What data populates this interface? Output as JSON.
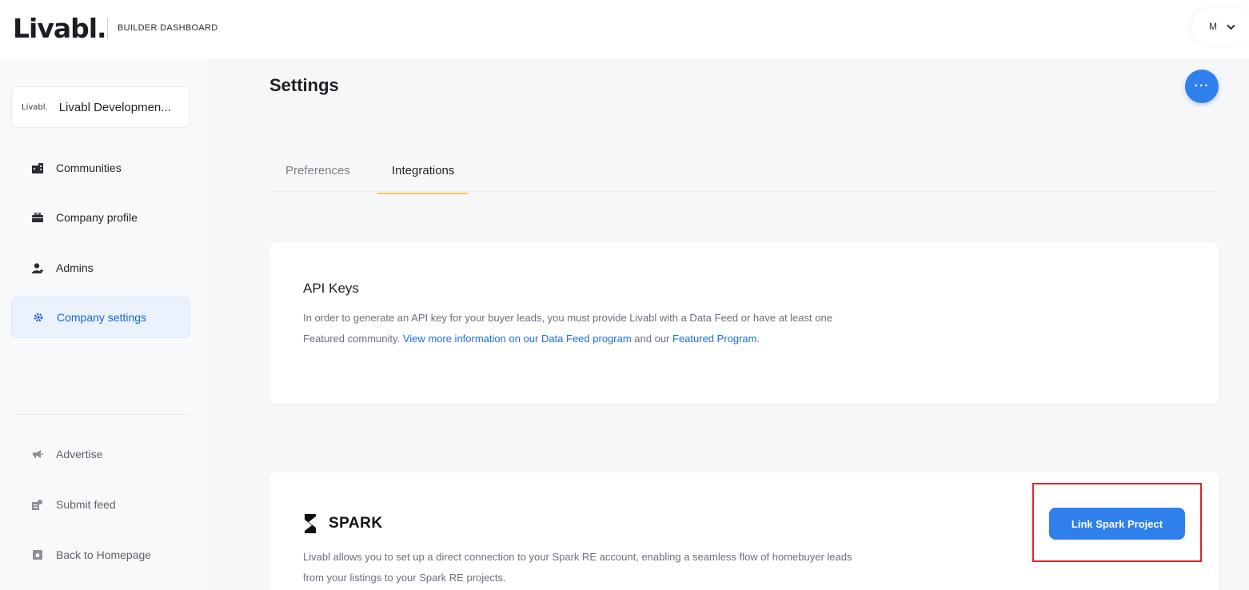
{
  "header": {
    "logo_text": "Livabl.",
    "dashboard_label": "BUILDER DASHBOARD",
    "user_initial": "M",
    "caret": "⌄"
  },
  "sidebar": {
    "company": {
      "mini_logo": "Livabl.",
      "name": "Livabl Developmen..."
    },
    "items": [
      {
        "label": "Communities",
        "icon": "building-icon",
        "active": false
      },
      {
        "label": "Company profile",
        "icon": "briefcase-icon",
        "active": false
      },
      {
        "label": "Admins",
        "icon": "user-add-icon",
        "active": false
      },
      {
        "label": "Company settings",
        "icon": "gear-icon",
        "active": true
      }
    ],
    "secondary_items": [
      {
        "label": "Advertise",
        "icon": "megaphone-icon"
      },
      {
        "label": "Submit feed",
        "icon": "feed-icon"
      },
      {
        "label": "Back to Homepage",
        "icon": "home-icon"
      }
    ]
  },
  "main": {
    "title": "Settings",
    "more_button": "···",
    "tabs": [
      {
        "label": "Preferences",
        "active": false
      },
      {
        "label": "Integrations",
        "active": true
      }
    ],
    "api_card": {
      "title": "API Keys",
      "text_1": "In order to generate an API key for your buyer leads, you must provide Livabl with a Data Feed or have at least one Featured community. ",
      "link_1": "View more information on our Data Feed program",
      "text_2": " and our ",
      "link_2": "Featured Program",
      "text_3": "."
    },
    "spark_card": {
      "brand": "SPARK",
      "button_label": "Link Spark Project",
      "description": "Livabl allows you to set up a direct connection to your Spark RE account, enabling a seamless flow of homebuyer leads from your listings to your Spark RE projects."
    }
  },
  "colors": {
    "accent": "#2f80ed",
    "active_nav_bg": "#eaf2fd",
    "tab_underline": "#f2c95a",
    "highlight": "#e1262a"
  }
}
